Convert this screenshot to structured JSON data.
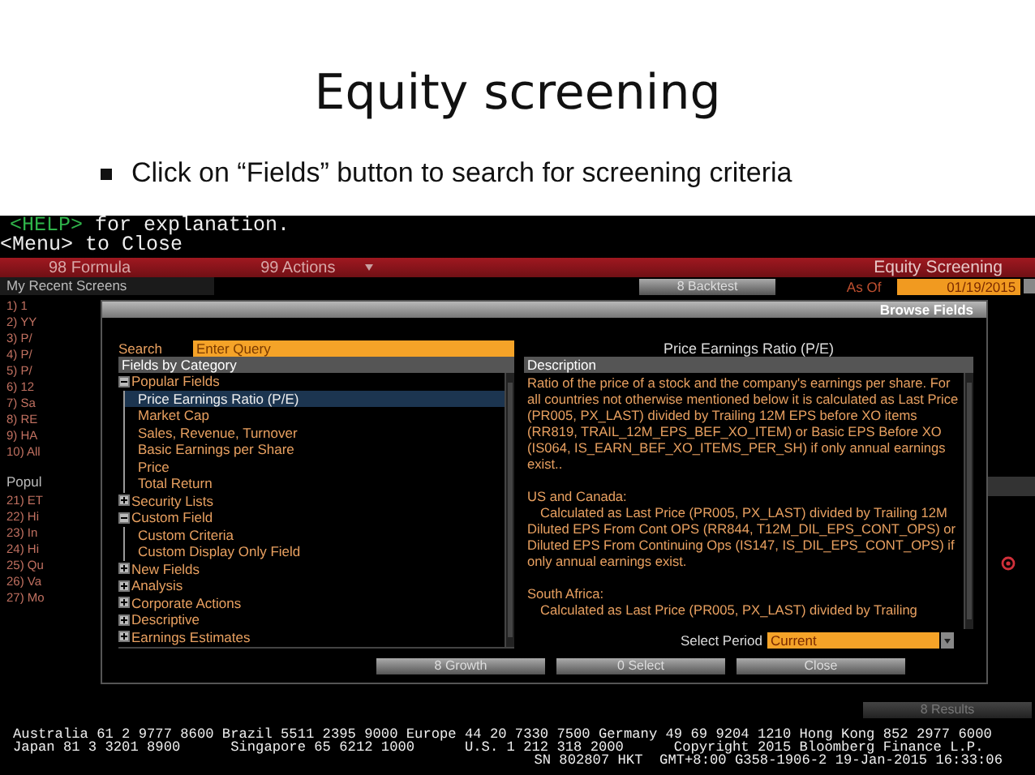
{
  "slide": {
    "title": "Equity screening",
    "bullet": "Click on “Fields” button to search for screening criteria"
  },
  "terminal": {
    "help_key": "<HELP>",
    "help_text": " for explanation.",
    "menu_line": "<Menu> to Close",
    "menu_bar": {
      "items": [
        "98 Formula",
        "99 Actions"
      ],
      "title": "Equity Screening"
    },
    "toolbar": {
      "recent_label": "My Recent Screens",
      "backtest": "8 Backtest",
      "as_of": "As Of",
      "date": "01/19/2015"
    },
    "recent_screens": [
      "1) 1",
      "2) YY",
      "3) P/",
      "4) P/",
      "5) P/",
      "6) 12",
      "7) Sa",
      "8) RE",
      "9) HA",
      "10) All"
    ],
    "popular_label": "Popul",
    "popular_screens": [
      "21) ET",
      "22) Hi",
      "23) In",
      "24) Hi",
      "25) Qu",
      "26) Va",
      "27) Mo"
    ],
    "results_button": "8 Results",
    "ticker": [
      "Australia 61 2 9777 8600 Brazil 5511 2395 9000 Europe 44 20 7330 7500 Germany 49 69 9204 1210 Hong Kong 852 2977 6000",
      "Japan 81 3 3201 8900      Singapore 65 6212 1000      U.S. 1 212 318 2000      Copyright 2015 Bloomberg Finance L.P.",
      "SN 802807 HKT  GMT+8:00 G358-1906-2 19-Jan-2015 16:33:06"
    ]
  },
  "dialog": {
    "title": "Browse Fields",
    "search_label": "Search",
    "search": {
      "placeholder": "Enter Query"
    },
    "tree_header": "Fields by Category",
    "tree": [
      {
        "label": "Popular Fields",
        "expanded": true,
        "children": [
          {
            "label": "Price Earnings Ratio (P/E)",
            "selected": true
          },
          {
            "label": "Market Cap",
            "selected": false
          },
          {
            "label": "Sales, Revenue, Turnover",
            "selected": false
          },
          {
            "label": "Basic Earnings per Share",
            "selected": false
          },
          {
            "label": "Price",
            "selected": false
          },
          {
            "label": "Total Return",
            "selected": false
          }
        ]
      },
      {
        "label": "Security Lists",
        "expanded": false
      },
      {
        "label": "Custom Field",
        "expanded": true,
        "children": [
          {
            "label": "Custom Criteria",
            "selected": false
          },
          {
            "label": "Custom Display Only Field",
            "selected": false
          }
        ]
      },
      {
        "label": "New Fields",
        "expanded": false
      },
      {
        "label": "Analysis",
        "expanded": false
      },
      {
        "label": "Corporate Actions",
        "expanded": false
      },
      {
        "label": "Descriptive",
        "expanded": false
      },
      {
        "label": "Earnings Estimates",
        "expanded": false
      }
    ],
    "field_title": "Price Earnings Ratio (P/E)",
    "description_header": "Description",
    "description": [
      {
        "kind": "text",
        "text": "Ratio of the price of a stock and the company's earnings per share. For all countries not otherwise mentioned below it is calculated as Last Price (PR005, PX_LAST) divided by Trailing 12M EPS before XO items (RR819, TRAIL_12M_EPS_BEF_XO_ITEM) or Basic EPS Before XO (IS064, IS_EARN_BEF_XO_ITEMS_PER_SH) if only annual earnings exist.."
      },
      {
        "kind": "heading",
        "text": "US and Canada:"
      },
      {
        "kind": "indent",
        "text": "Calculated as Last Price (PR005, PX_LAST) divided by Trailing 12M Diluted EPS From Cont OPS (RR844, T12M_DIL_EPS_CONT_OPS) or Diluted EPS From Continuing Ops (IS147, IS_DIL_EPS_CONT_OPS) if only annual earnings exist."
      },
      {
        "kind": "heading",
        "text": "South Africa:"
      },
      {
        "kind": "indent",
        "text": "Calculated as Last Price (PR005, PX_LAST) divided by Trailing"
      }
    ],
    "period_label": "Select Period",
    "period_value": "Current",
    "buttons": [
      "8 Growth",
      "0 Select",
      "Close"
    ]
  }
}
